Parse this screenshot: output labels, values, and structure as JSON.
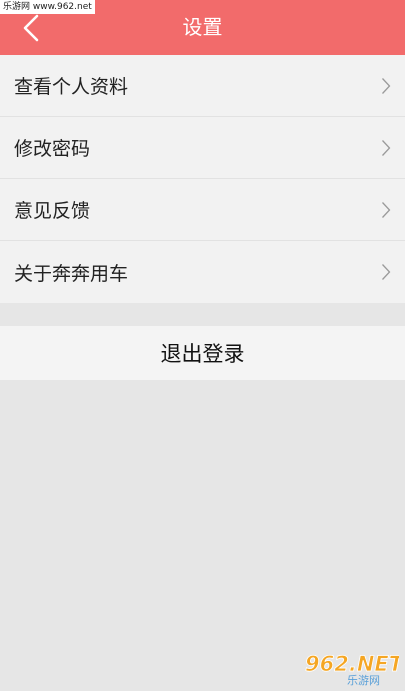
{
  "watermark_top": "乐游网 www.962.net",
  "header": {
    "title": "设置",
    "back_icon": "chevron-left-icon",
    "background_color": "#f26b6b"
  },
  "menu": {
    "items": [
      {
        "label": "查看个人资料",
        "icon": "chevron-right-icon"
      },
      {
        "label": "修改密码",
        "icon": "chevron-right-icon"
      },
      {
        "label": "意见反馈",
        "icon": "chevron-right-icon"
      },
      {
        "label": "关于奔奔用车",
        "icon": "chevron-right-icon"
      }
    ]
  },
  "logout": {
    "label": "退出登录"
  },
  "watermark_bottom": {
    "brand": "962.NET",
    "subtitle": "乐游网"
  }
}
